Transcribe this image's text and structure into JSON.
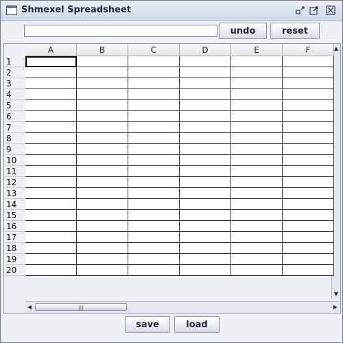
{
  "window": {
    "title": "Shmexel Spreadsheet"
  },
  "toolbar": {
    "formula_value": "",
    "undo_label": "undo",
    "reset_label": "reset"
  },
  "sheet": {
    "columns": [
      "A",
      "B",
      "C",
      "D",
      "E",
      "F"
    ],
    "rows": [
      "1",
      "2",
      "3",
      "4",
      "5",
      "6",
      "7",
      "8",
      "9",
      "10",
      "11",
      "12",
      "13",
      "14",
      "15",
      "16",
      "17",
      "18",
      "19",
      "20"
    ],
    "selected_cell": "A1"
  },
  "footer": {
    "save_label": "save",
    "load_label": "load"
  },
  "icons": {
    "minimize": "minimize-icon",
    "maximize": "maximize-icon",
    "close": "close-icon"
  }
}
